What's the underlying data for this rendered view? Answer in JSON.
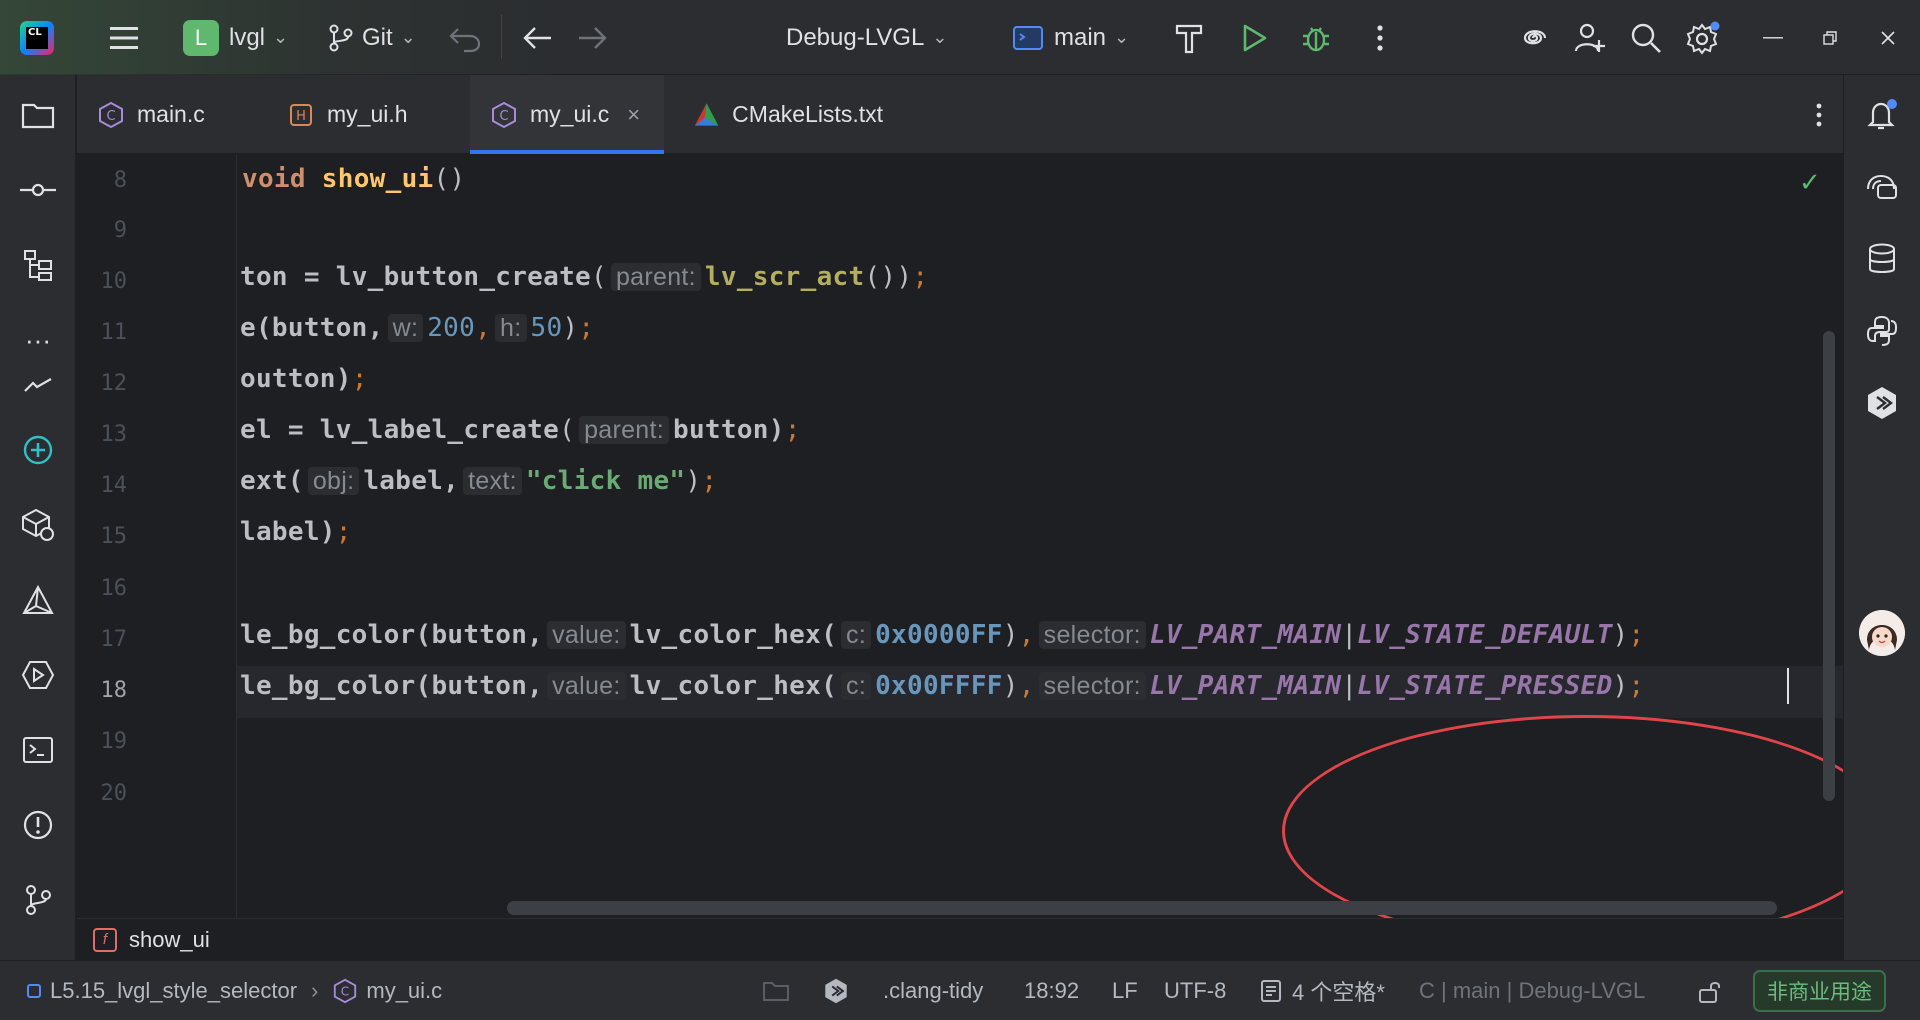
{
  "titlebar": {
    "project_badge": "L",
    "project_name": "lvgl",
    "vcs": "Git",
    "run_config": "Debug-LVGL",
    "target": "main"
  },
  "tabs": [
    {
      "label": "main.c",
      "icon": "c-file-icon"
    },
    {
      "label": "my_ui.h",
      "icon": "h-file-icon"
    },
    {
      "label": "my_ui.c",
      "icon": "c-file-icon",
      "active": true
    },
    {
      "label": "CMakeLists.txt",
      "icon": "cmake-icon"
    }
  ],
  "editor": {
    "line_numbers": [
      "8",
      "9",
      "10",
      "11",
      "12",
      "13",
      "14",
      "15",
      "16",
      "17",
      "18",
      "19",
      "20"
    ],
    "current_line": "18",
    "code": {
      "l8_kw": "void",
      "l8_fn": "show_ui",
      "l8_rest": "()",
      "l10_a": "ton = ",
      "l10_fn": "lv_button_create",
      "l10_hint": "parent:",
      "l10_mac": "lv_scr_act",
      "l10_end": "())",
      "l11_a": "e(button,",
      "l11_hint_w": "w:",
      "l11_w": "200",
      "l11_hint_h": "h:",
      "l11_h": "50",
      "l11_end": ")",
      "l12_a": "outton)",
      "l13_a": "el = ",
      "l13_fn": "lv_label_create",
      "l13_hint": "parent:",
      "l13_end": "button)",
      "l14_a": "ext(",
      "l14_hint_obj": "obj:",
      "l14_b": "label,",
      "l14_hint_text": "text:",
      "l14_str": "\"click me\"",
      "l14_end": ")",
      "l15_a": "label)",
      "l17_a": "le_bg_color(button,",
      "l17_hint_value": "value:",
      "l17_fn": "lv_color_hex(",
      "l17_hint_c": "c:",
      "l17_num": "0x0000FF",
      "l17_close": ")",
      "l17_hint_sel": "selector:",
      "l17_part": "LV_PART_MAIN",
      "l17_state": "LV_STATE_DEFAULT",
      "l17_end": ")",
      "l18_a": "le_bg_color(button,",
      "l18_hint_value": "value:",
      "l18_fn": "lv_color_hex(",
      "l18_hint_c": "c:",
      "l18_num": "0x00FFFF",
      "l18_close": ")",
      "l18_hint_sel": "selector:",
      "l18_part": "LV_PART_MAIN",
      "l18_state": "LV_STATE_PRESSED",
      "l18_end": ")"
    }
  },
  "breadcrumb": {
    "function": "show_ui"
  },
  "statusbar": {
    "project": "L5.15_lvgl_style_selector",
    "file": "my_ui.c",
    "linter": ".clang-tidy",
    "position": "18:92",
    "line_ending": "LF",
    "encoding": "UTF-8",
    "indent": "4 个空格*",
    "context": "C | main | Debug-LVGL",
    "license": "非商业用途"
  },
  "colors": {
    "accent": "#3574f0",
    "annotation": "#e0454a",
    "success": "#5fb86e"
  }
}
